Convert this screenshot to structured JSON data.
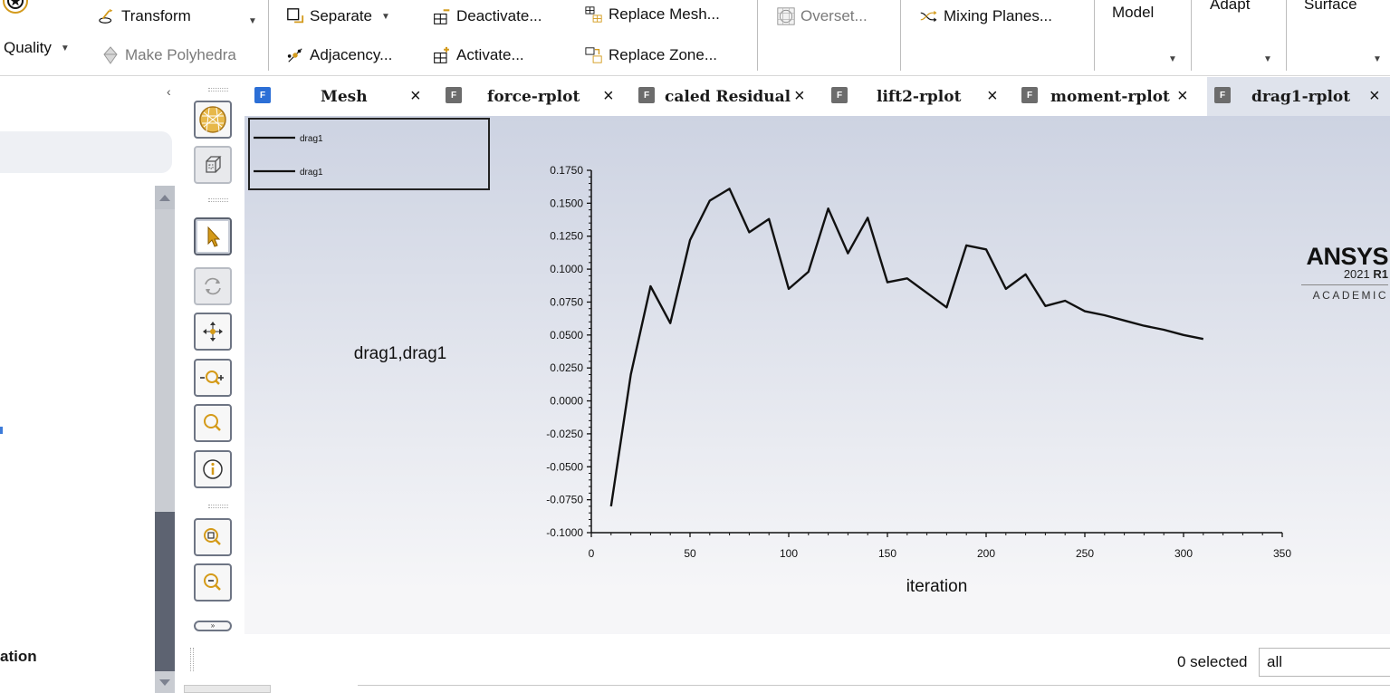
{
  "ribbon": {
    "quality_label": "Quality",
    "transform_label": "Transform",
    "make_polyhedra_label": "Make Polyhedra",
    "separate_label": "Separate",
    "adjacency_label": "Adjacency...",
    "deactivate_label": "Deactivate...",
    "activate_label": "Activate...",
    "replace_mesh_label": "Replace Mesh...",
    "replace_zone_label": "Replace Zone...",
    "overset_label": "Overset...",
    "mixing_planes_label": "Mixing Planes...",
    "model_label": "Model",
    "adapt_label": "Adapt",
    "surface_label": "Surface"
  },
  "left_panel": {
    "partial_label": "ation"
  },
  "tabs": [
    {
      "label": "Mesh",
      "icon": "fluent-tab-icon",
      "active": false
    },
    {
      "label": "force-rplot",
      "icon": "fluent-tab-icon",
      "active": false
    },
    {
      "label": "caled Residual",
      "icon": "fluent-tab-icon",
      "active": false
    },
    {
      "label": "lift2-rplot",
      "icon": "fluent-tab-icon",
      "active": false
    },
    {
      "label": "moment-rplot",
      "icon": "fluent-tab-icon",
      "active": false
    },
    {
      "label": "drag1-rplot",
      "icon": "fluent-tab-icon",
      "active": true
    }
  ],
  "graphics_toolbar": [
    "mesh-display-icon",
    "bounding-box-icon",
    "select-arrow-icon",
    "rotate-icon",
    "pan-icon",
    "zoom-in-out-icon",
    "zoom-to-fit-icon",
    "probe-info-icon",
    "zoom-box-icon",
    "zoom-out-icon",
    "expand-more-icon"
  ],
  "logo": {
    "brand": "ANSYS",
    "year": "2021",
    "release": "R1",
    "edition": "ACADEMIC"
  },
  "status": {
    "selected_text": "0 selected",
    "filter_value": "all"
  },
  "colors": {
    "plot_line": "#111111",
    "tab_active_bg": "#dfe3ec",
    "tab_icon_blue": "#2c6fd6",
    "tab_icon_gray": "#6c6c6c",
    "ribbon_icon_gold": "#d39a1c"
  },
  "chart_data": {
    "type": "line",
    "ylabel": "drag1,drag1",
    "xlabel": "iteration",
    "legend": [
      "drag1",
      "drag1"
    ],
    "legend_position": "top-left",
    "xlim": [
      0,
      350
    ],
    "ylim": [
      -0.1,
      0.175
    ],
    "x_ticks": [
      "0",
      "50",
      "100",
      "150",
      "200",
      "250",
      "300",
      "350"
    ],
    "y_ticks": [
      "0.1750",
      "0.1500",
      "0.1250",
      "0.1000",
      "0.0750",
      "0.0500",
      "0.0250",
      "0.0000",
      "-0.0250",
      "-0.0500",
      "-0.0750",
      "-0.1000"
    ],
    "series": [
      {
        "name": "drag1",
        "x": [
          10,
          20,
          30,
          40,
          50,
          60,
          70,
          80,
          90,
          100,
          110,
          120,
          130,
          140,
          150,
          160,
          170,
          180,
          190,
          200,
          210,
          220,
          230,
          240,
          250,
          260,
          270,
          280,
          290,
          300,
          310
        ],
        "y": [
          -0.08,
          0.02,
          0.087,
          0.059,
          0.122,
          0.152,
          0.161,
          0.128,
          0.138,
          0.085,
          0.098,
          0.146,
          0.112,
          0.139,
          0.09,
          0.093,
          0.082,
          0.071,
          0.118,
          0.115,
          0.085,
          0.096,
          0.072,
          0.076,
          0.068,
          0.065,
          0.061,
          0.057,
          0.054,
          0.05,
          0.047
        ]
      }
    ]
  }
}
